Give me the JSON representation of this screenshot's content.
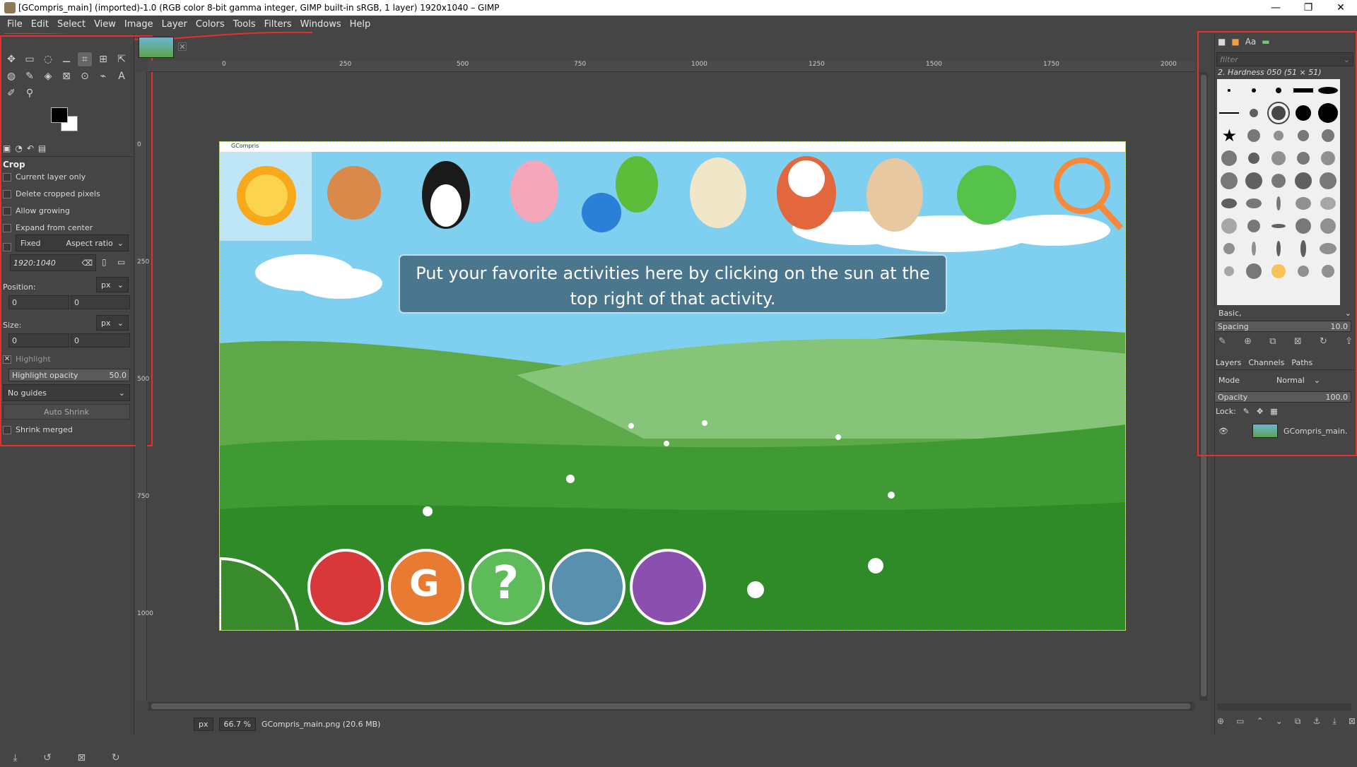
{
  "window": {
    "title": "[GCompris_main] (imported)-1.0 (RGB color 8-bit gamma integer, GIMP built-in sRGB, 1 layer) 1920x1040 – GIMP",
    "minimize": "—",
    "maximize": "❐",
    "close": "✕"
  },
  "menubar": [
    "File",
    "Edit",
    "Select",
    "View",
    "Image",
    "Layer",
    "Colors",
    "Tools",
    "Filters",
    "Windows",
    "Help"
  ],
  "toolbox": {
    "tools": [
      "✥",
      "▭",
      "◌",
      "⚊",
      "⌗",
      "⊞",
      "⇱",
      "◍",
      "✎",
      "◈",
      "⊠",
      "⊙",
      "⌁",
      "A",
      "✐",
      "⚲"
    ],
    "options_title": "Crop",
    "current_layer_only": "Current layer only",
    "delete_cropped": "Delete cropped pixels",
    "allow_growing": "Allow growing",
    "expand_center": "Expand from center",
    "fixed": "Fixed",
    "aspect_ratio": "Aspect ratio",
    "ratio_value": "1920:1040",
    "position_label": "Position:",
    "size_label": "Size:",
    "unit": "px",
    "pos_x": "0",
    "pos_y": "0",
    "size_w": "0",
    "size_h": "0",
    "highlight": "Highlight",
    "highlight_opacity": "Highlight opacity",
    "highlight_value": "50.0",
    "guides": "No guides",
    "auto_shrink": "Auto Shrink",
    "shrink_merged": "Shrink merged"
  },
  "ruler": {
    "h_labels": [
      "0",
      "250",
      "500",
      "750",
      "1000",
      "1250",
      "1500",
      "1750",
      "2000"
    ],
    "v_labels": [
      "0",
      "250",
      "500",
      "750",
      "1000"
    ]
  },
  "canvas": {
    "app_title": "GCompris",
    "message": "Put your favorite activities here by clicking on the sun at the top right of that activity."
  },
  "statusbar": {
    "unit": "px",
    "zoom": "66.7 %",
    "file": "GCompris_main.png (20.6 MB)"
  },
  "rightpanel": {
    "filter_placeholder": "filter",
    "brush_name": "2. Hardness 050 (51 × 51)",
    "preset": "Basic,",
    "spacing_label": "Spacing",
    "spacing_value": "10.0",
    "tab_layers": "Layers",
    "tab_channels": "Channels",
    "tab_paths": "Paths",
    "mode_label": "Mode",
    "mode_value": "Normal",
    "opacity_label": "Opacity",
    "opacity_value": "100.0",
    "lock_label": "Lock:",
    "layer_name": "GCompris_main."
  },
  "colors": {
    "annotation_red": "#e53030",
    "sky": "#7fd0f0",
    "grass": "#4ea23c"
  }
}
